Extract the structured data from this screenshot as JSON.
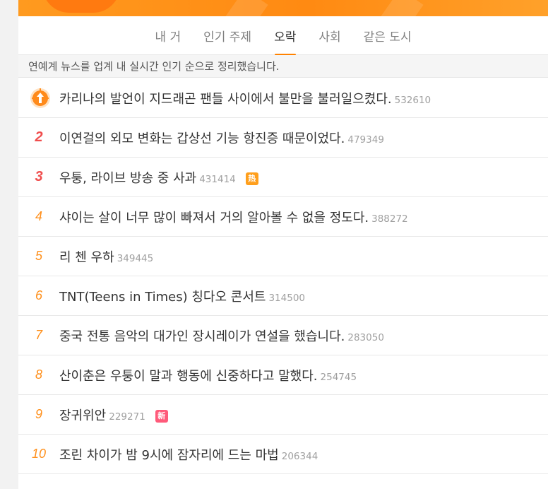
{
  "tabs": [
    {
      "label": "내 거",
      "active": false
    },
    {
      "label": "인기 주제",
      "active": false
    },
    {
      "label": "오락",
      "active": true
    },
    {
      "label": "사회",
      "active": false
    },
    {
      "label": "같은 도시",
      "active": false
    }
  ],
  "notice": "연예계 뉴스를 업계 내 실시간 인기 순으로 정리했습니다.",
  "accent_color": "#ff8200",
  "items": [
    {
      "rank": "",
      "icon": "pin-top-icon",
      "title": "카리나의 발언이 지드래곤 팬들 사이에서 불만을 불러일으켰다.",
      "count": "532610",
      "badge": ""
    },
    {
      "rank": "2",
      "title": "이연걸의 외모 변화는 갑상선 기능 항진증 때문이었다.",
      "count": "479349",
      "badge": ""
    },
    {
      "rank": "3",
      "title": "우퉁, 라이브 방송 중 사과",
      "count": "431414",
      "badge": "热"
    },
    {
      "rank": "4",
      "title": "샤이는 살이 너무 많이 빠져서 거의 알아볼 수 없을 정도다.",
      "count": "388272",
      "badge": ""
    },
    {
      "rank": "5",
      "title": "리 첸 우하",
      "count": "349445",
      "badge": ""
    },
    {
      "rank": "6",
      "title": "TNT(Teens in Times) 칭다오 콘서트",
      "count": "314500",
      "badge": ""
    },
    {
      "rank": "7",
      "title": "중국 전통 음악의 대가인 장시레이가 연설을 했습니다.",
      "count": "283050",
      "badge": ""
    },
    {
      "rank": "8",
      "title": "산이춘은 우퉁이 말과 행동에 신중하다고 말했다.",
      "count": "254745",
      "badge": ""
    },
    {
      "rank": "9",
      "title": "장귀위안",
      "count": "229271",
      "badge": "新"
    },
    {
      "rank": "10",
      "title": "조린 차이가 밤 9시에 잠자리에 드는 마법",
      "count": "206344",
      "badge": ""
    }
  ]
}
